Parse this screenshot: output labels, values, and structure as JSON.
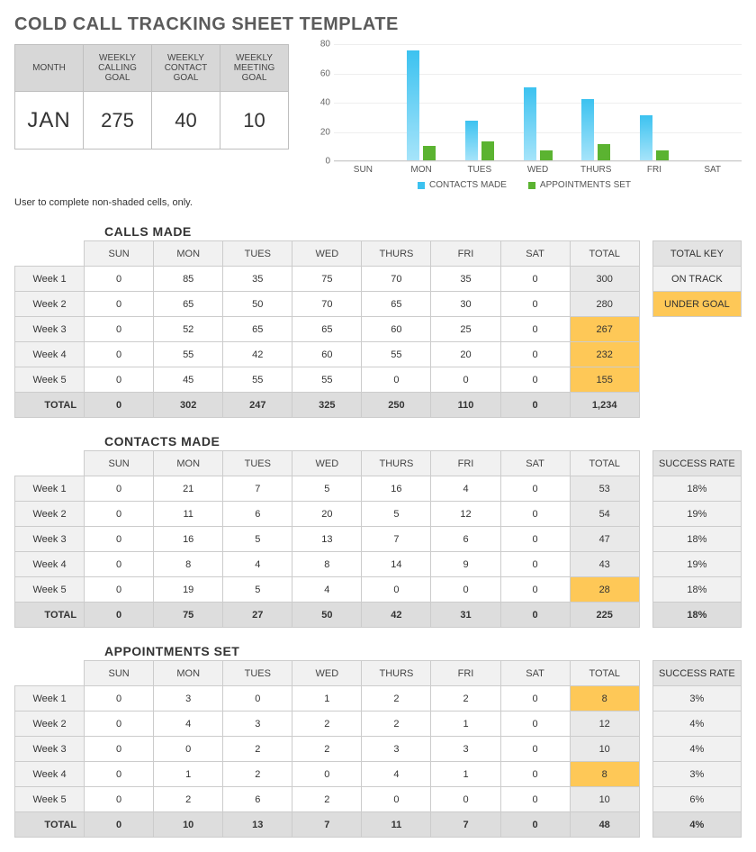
{
  "title": "COLD CALL TRACKING SHEET TEMPLATE",
  "goals": {
    "headers": [
      "MONTH",
      "WEEKLY CALLING GOAL",
      "WEEKLY CONTACT GOAL",
      "WEEKLY MEETING GOAL"
    ],
    "month": "JAN",
    "calling": "275",
    "contact": "40",
    "meeting": "10"
  },
  "note": "User to complete non-shaded cells, only.",
  "chart_data": {
    "type": "bar",
    "categories": [
      "SUN",
      "MON",
      "TUES",
      "WED",
      "THURS",
      "FRI",
      "SAT"
    ],
    "series": [
      {
        "name": "CONTACTS MADE",
        "values": [
          0,
          75,
          27,
          50,
          42,
          31,
          0
        ]
      },
      {
        "name": "APPOINTMENTS SET",
        "values": [
          0,
          10,
          13,
          7,
          11,
          7,
          0
        ]
      }
    ],
    "ylim": [
      0,
      80
    ],
    "yticks": [
      0,
      20,
      40,
      60,
      80
    ]
  },
  "days": [
    "SUN",
    "MON",
    "TUES",
    "WED",
    "THURS",
    "FRI",
    "SAT",
    "TOTAL"
  ],
  "key": {
    "header": "TOTAL KEY",
    "ontrack": "ON TRACK",
    "under": "UNDER GOAL"
  },
  "calls": {
    "title": "CALLS MADE",
    "rows": [
      {
        "label": "Week 1",
        "v": [
          "0",
          "85",
          "35",
          "75",
          "70",
          "35",
          "0"
        ],
        "total": "300",
        "under": false
      },
      {
        "label": "Week 2",
        "v": [
          "0",
          "65",
          "50",
          "70",
          "65",
          "30",
          "0"
        ],
        "total": "280",
        "under": false
      },
      {
        "label": "Week 3",
        "v": [
          "0",
          "52",
          "65",
          "65",
          "60",
          "25",
          "0"
        ],
        "total": "267",
        "under": true
      },
      {
        "label": "Week 4",
        "v": [
          "0",
          "55",
          "42",
          "60",
          "55",
          "20",
          "0"
        ],
        "total": "232",
        "under": true
      },
      {
        "label": "Week 5",
        "v": [
          "0",
          "45",
          "55",
          "55",
          "0",
          "0",
          "0"
        ],
        "total": "155",
        "under": true
      }
    ],
    "totals": {
      "label": "TOTAL",
      "v": [
        "0",
        "302",
        "247",
        "325",
        "250",
        "110",
        "0"
      ],
      "grand": "1,234"
    }
  },
  "contacts": {
    "title": "CONTACTS MADE",
    "rate_header": "SUCCESS RATE",
    "rows": [
      {
        "label": "Week 1",
        "v": [
          "0",
          "21",
          "7",
          "5",
          "16",
          "4",
          "0"
        ],
        "total": "53",
        "under": false,
        "rate": "18%"
      },
      {
        "label": "Week 2",
        "v": [
          "0",
          "11",
          "6",
          "20",
          "5",
          "12",
          "0"
        ],
        "total": "54",
        "under": false,
        "rate": "19%"
      },
      {
        "label": "Week 3",
        "v": [
          "0",
          "16",
          "5",
          "13",
          "7",
          "6",
          "0"
        ],
        "total": "47",
        "under": false,
        "rate": "18%"
      },
      {
        "label": "Week 4",
        "v": [
          "0",
          "8",
          "4",
          "8",
          "14",
          "9",
          "0"
        ],
        "total": "43",
        "under": false,
        "rate": "19%"
      },
      {
        "label": "Week 5",
        "v": [
          "0",
          "19",
          "5",
          "4",
          "0",
          "0",
          "0"
        ],
        "total": "28",
        "under": true,
        "rate": "18%"
      }
    ],
    "totals": {
      "label": "TOTAL",
      "v": [
        "0",
        "75",
        "27",
        "50",
        "42",
        "31",
        "0"
      ],
      "grand": "225",
      "rate": "18%"
    }
  },
  "appts": {
    "title": "APPOINTMENTS SET",
    "rate_header": "SUCCESS RATE",
    "rows": [
      {
        "label": "Week 1",
        "v": [
          "0",
          "3",
          "0",
          "1",
          "2",
          "2",
          "0"
        ],
        "total": "8",
        "under": true,
        "rate": "3%"
      },
      {
        "label": "Week 2",
        "v": [
          "0",
          "4",
          "3",
          "2",
          "2",
          "1",
          "0"
        ],
        "total": "12",
        "under": false,
        "rate": "4%"
      },
      {
        "label": "Week 3",
        "v": [
          "0",
          "0",
          "2",
          "2",
          "3",
          "3",
          "0"
        ],
        "total": "10",
        "under": false,
        "rate": "4%"
      },
      {
        "label": "Week 4",
        "v": [
          "0",
          "1",
          "2",
          "0",
          "4",
          "1",
          "0"
        ],
        "total": "8",
        "under": true,
        "rate": "3%"
      },
      {
        "label": "Week 5",
        "v": [
          "0",
          "2",
          "6",
          "2",
          "0",
          "0",
          "0"
        ],
        "total": "10",
        "under": false,
        "rate": "6%"
      }
    ],
    "totals": {
      "label": "TOTAL",
      "v": [
        "0",
        "10",
        "13",
        "7",
        "11",
        "7",
        "0"
      ],
      "grand": "48",
      "rate": "4%"
    }
  }
}
